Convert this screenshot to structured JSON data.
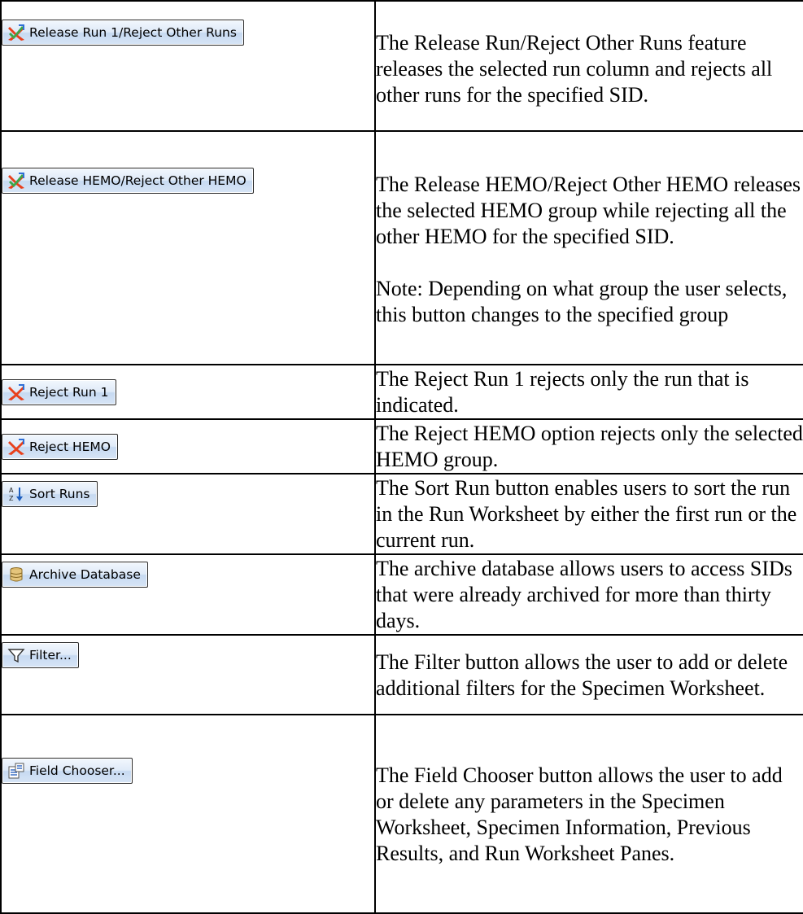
{
  "rows": [
    {
      "button_label": "Release Run 1/Reject Other Runs",
      "button_icon": "release-reject-icon",
      "description": "The Release Run/Reject Other Runs feature releases the selected run column and rejects all other runs for the specified SID."
    },
    {
      "button_label": "Release HEMO/Reject Other HEMO",
      "button_icon": "release-reject-icon",
      "description": "The Release HEMO/Reject Other HEMO releases the selected HEMO group while rejecting all the other HEMO for the specified SID.",
      "note": "Note:  Depending on what group the user selects, this button changes to the specified group"
    },
    {
      "button_label": "Reject Run 1",
      "button_icon": "reject-icon",
      "description": "The Reject Run 1 rejects only the run that is indicated."
    },
    {
      "button_label": "Reject HEMO",
      "button_icon": "reject-icon",
      "description": "The Reject HEMO option rejects only the selected HEMO group."
    },
    {
      "button_label": "Sort Runs",
      "button_icon": "sort-az-icon",
      "description": "The Sort Run button enables users to sort the run in the Run Worksheet by either the first run or the current run."
    },
    {
      "button_label": "Archive Database",
      "button_icon": "database-icon",
      "description": "The archive database allows users to access SIDs that were already archived for more than thirty days."
    },
    {
      "button_label": "Filter...",
      "button_icon": "filter-icon",
      "description": "The Filter button allows the user to add or delete additional filters for the Specimen Worksheet."
    },
    {
      "button_label": "Field Chooser...",
      "button_icon": "field-chooser-icon",
      "description": "The Field Chooser button allows the user to add or delete any parameters in the Specimen Worksheet, Specimen Information, Previous Results, and Run Worksheet Panes."
    }
  ]
}
